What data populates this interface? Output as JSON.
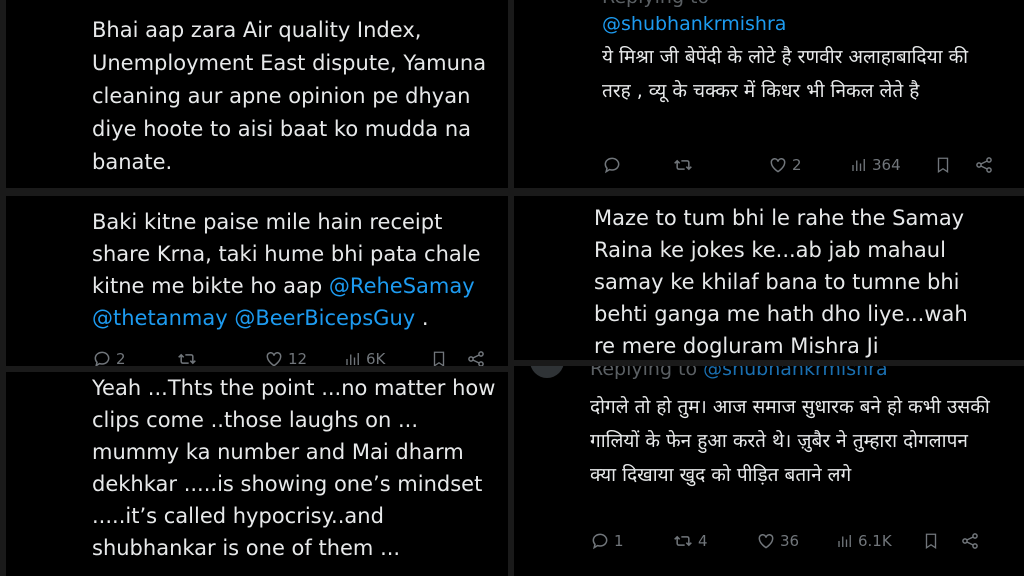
{
  "panels": {
    "p1": {
      "text": "Bhai aap zara Air quality Index, Unemployment East dispute, Yamuna cleaning aur apne opinion pe dhyan diye hoote to aisi baat ko mudda na banate."
    },
    "p2": {
      "reply_prefix": "Replying to",
      "mention": "@shubhankrmishra",
      "text": "ये मिश्रा जी बेपेंदी के लोटे है रणवीर अलाहाबादिया की तरह , व्यू के चक्कर में किधर भी निकल लेते है",
      "reply_count": "",
      "repost_count": "",
      "like_count": "2",
      "view_count": "364"
    },
    "p3": {
      "text_before": "Baki kitne paise mile hain receipt share Krna, taki hume bhi pata chale kitne me bikte ho aap ",
      "mention1": "@ReheSamay",
      "mention2": "@thetanmay",
      "mention3": "@BeerBicepsGuy",
      "text_after": " .",
      "reply_count": "2",
      "repost_count": "",
      "like_count": "12",
      "view_count": "6K"
    },
    "p4": {
      "text": "Maze to tum bhi le rahe the Samay Raina ke jokes ke...ab jab mahaul samay ke khilaf bana to tumne bhi behti ganga me hath dho liye...wah re mere dogluram Mishra Ji"
    },
    "p5": {
      "text": "Yeah ...Thts the point ...no matter how clips come ..those laughs on ... mummy ka number and Mai dharm dekhkar .....is showing one’s mindset .....it’s called hypocrisy..and shubhankar is one of them ..."
    },
    "p6": {
      "reply_prefix": "Replying to",
      "mention": "@shubhankrmishra",
      "text": "दोगले तो हो तुम। आज समाज सुधारक बने हो कभी उसकी गालियों के फेन हुआ करते थे। ज़ुबैर ने तुम्हारा दोगलापन क्या दिखाया खुद को पीड़ित बताने लगे",
      "reply_count": "1",
      "repost_count": "4",
      "like_count": "36",
      "view_count": "6.1K"
    }
  },
  "colors": {
    "background": "#000000",
    "separator": "#1a1a1a",
    "text": "#e7e9ea",
    "mention": "#1d9bf0",
    "muted": "#71767b"
  },
  "icons": [
    "reply-icon",
    "repost-icon",
    "like-icon",
    "views-icon",
    "bookmark-icon",
    "share-icon"
  ]
}
